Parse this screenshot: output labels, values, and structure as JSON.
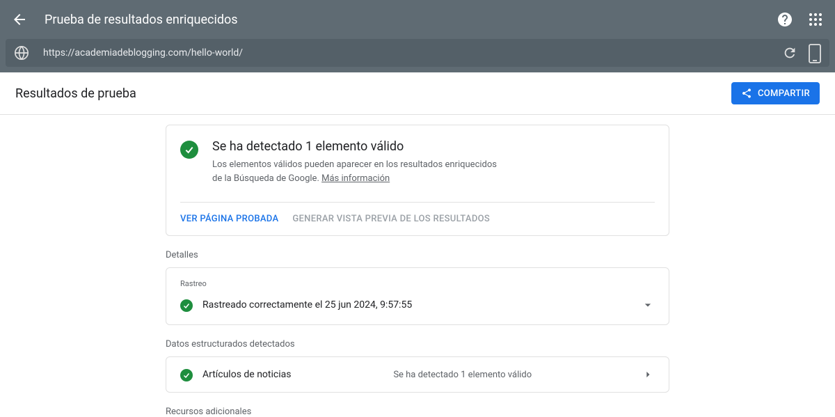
{
  "header": {
    "title": "Prueba de resultados enriquecidos"
  },
  "urlbar": {
    "url": "https://academiadeblogging.com/hello-world/"
  },
  "subheader": {
    "title": "Resultados de prueba",
    "share_label": "COMPARTIR"
  },
  "result": {
    "title": "Se ha detectado 1 elemento válido",
    "desc_pre": "Los elementos válidos pueden aparecer en los resultados enriquecidos de la Búsqueda de Google. ",
    "link": "Más información"
  },
  "tabs": {
    "tested": "VER PÁGINA PROBADA",
    "preview": "GENERAR VISTA PREVIA DE LOS RESULTADOS"
  },
  "details": {
    "label": "Detalles",
    "crawl_label": "Rastreo",
    "crawl_text": "Rastreado correctamente el 25 jun 2024, 9:57:55"
  },
  "structured": {
    "label": "Datos estructurados detectados",
    "item_name": "Artículos de noticias",
    "item_status": "Se ha detectado 1 elemento válido"
  },
  "additional": {
    "label": "Recursos adicionales"
  }
}
